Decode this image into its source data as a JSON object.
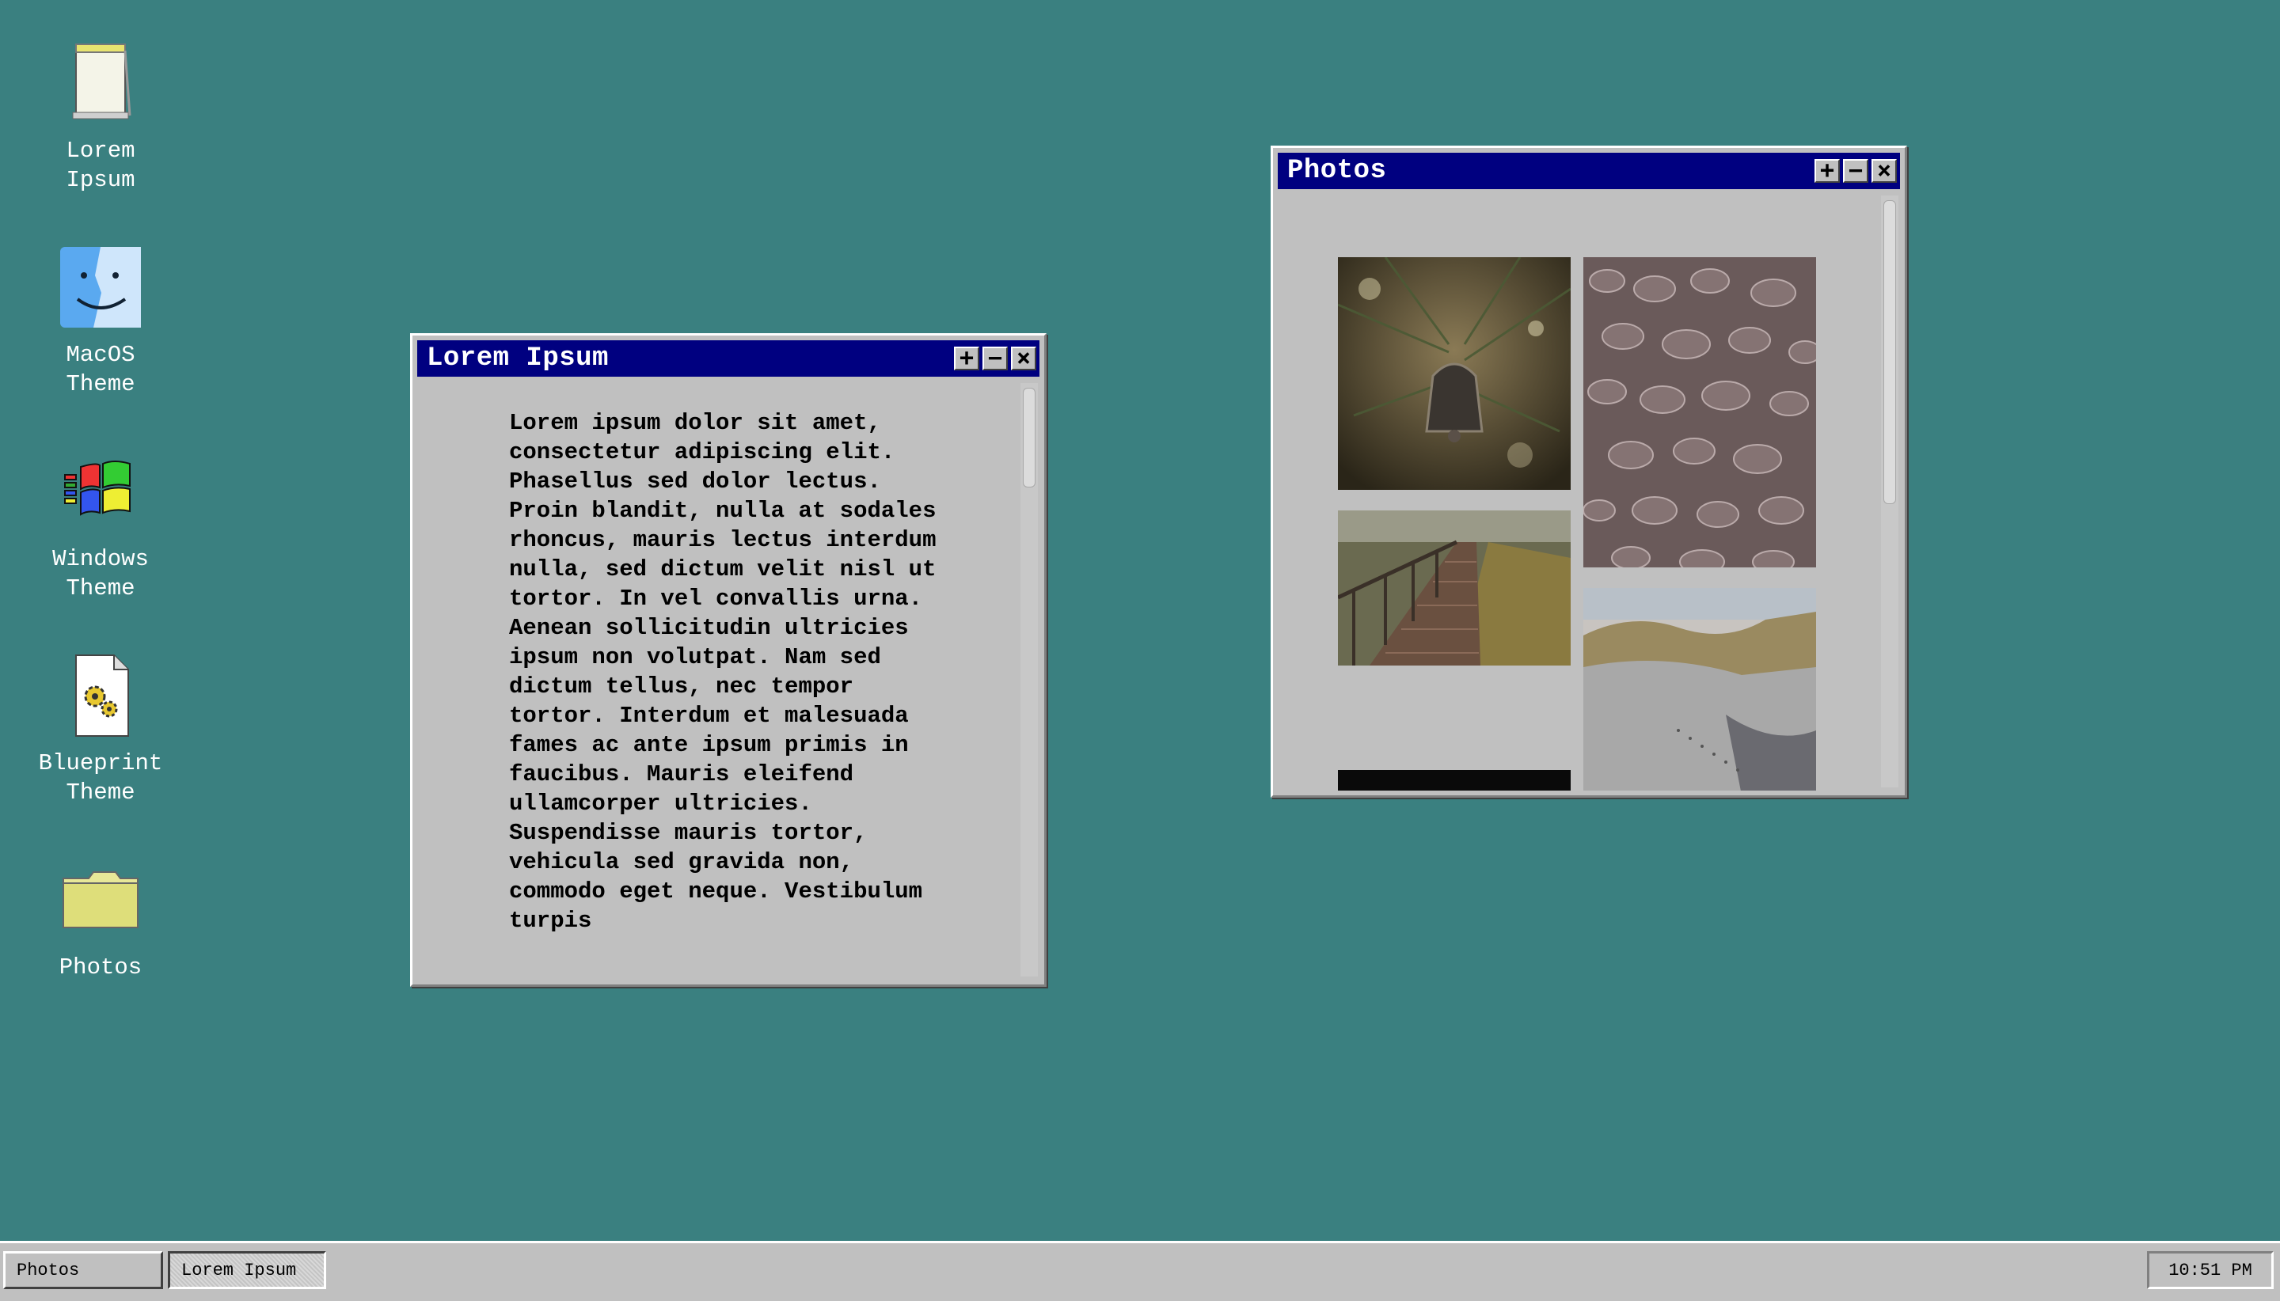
{
  "desktop": {
    "background": "#3a8080",
    "icons": [
      {
        "id": "lorem",
        "line1": "Lorem",
        "line2": "Ipsum",
        "icon": "notepad-icon"
      },
      {
        "id": "macos",
        "line1": "MacOS",
        "line2": "Theme",
        "icon": "finder-icon"
      },
      {
        "id": "windows",
        "line1": "Windows",
        "line2": "Theme",
        "icon": "windows-logo-icon"
      },
      {
        "id": "blueprint",
        "line1": "Blueprint",
        "line2": "Theme",
        "icon": "gear-document-icon"
      },
      {
        "id": "photos",
        "line1": "Photos",
        "line2": "",
        "icon": "folder-icon"
      }
    ]
  },
  "windows": {
    "lorem": {
      "title": "Lorem Ipsum",
      "body": "Lorem ipsum dolor sit amet, consectetur adipiscing elit. Phasellus sed dolor lectus. Proin blandit, nulla at sodales rhoncus, mauris lectus interdum nulla, sed dictum velit nisl ut tortor. In vel convallis urna. Aenean sollicitudin ultricies ipsum non volutpat. Nam sed dictum tellus, nec tempor tortor. Interdum et malesuada fames ac ante ipsum primis in faucibus. Mauris eleifend ullamcorper ultricies. Suspendisse mauris tortor, vehicula sed gravida non, commodo eget neque. Vestibulum turpis"
    },
    "photos": {
      "title": "Photos",
      "images": [
        "christmas-bell-ornament-photo",
        "pebbles-texture-photo",
        "wooden-boardwalk-photo",
        "sand-dunes-photo",
        "dark-photo"
      ]
    },
    "controls": {
      "maximize": "+",
      "minimize": "−",
      "close": "×"
    }
  },
  "taskbar": {
    "buttons": [
      "Photos",
      "Lorem Ipsum"
    ],
    "active": "Lorem Ipsum",
    "clock": "10:51 PM"
  },
  "colors": {
    "titlebar": "#000080",
    "window": "#c0c0c0",
    "desktop": "#3a8080"
  }
}
